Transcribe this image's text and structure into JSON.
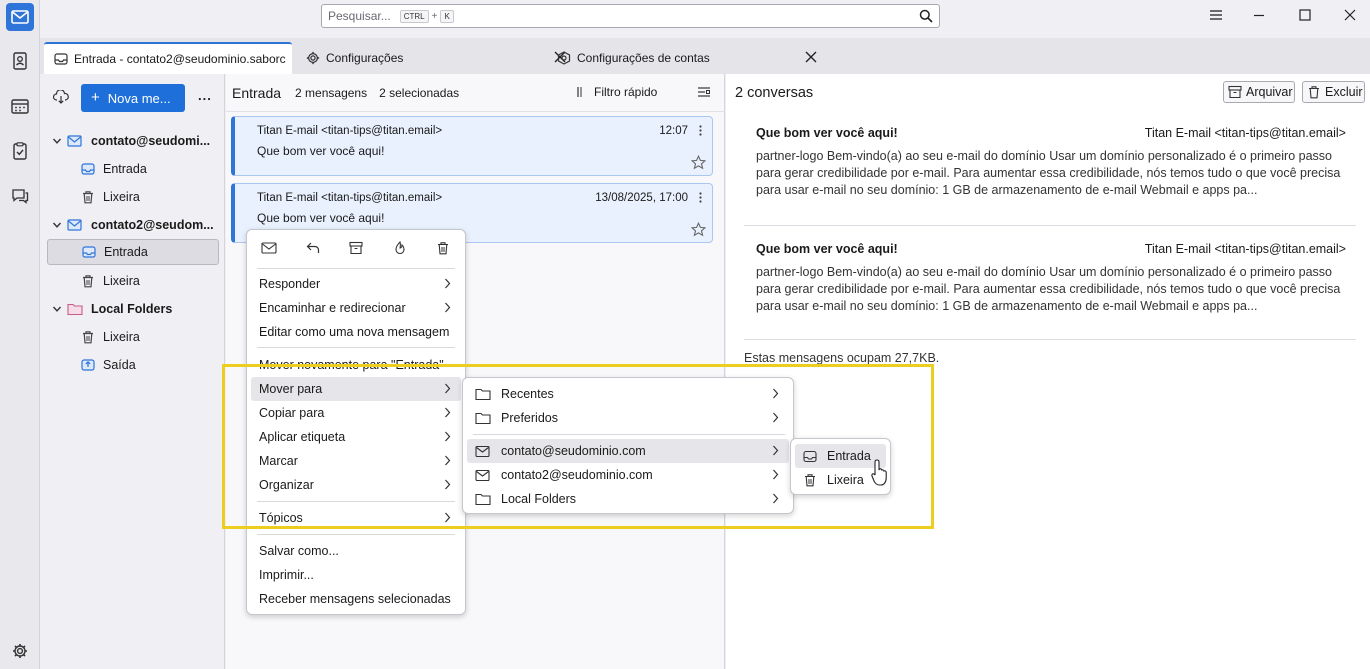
{
  "search": {
    "placeholder": "Pesquisar...",
    "key1": "CTRL",
    "plus": "+",
    "key2": "K"
  },
  "tabs": [
    {
      "label": "Entrada - contato2@seudominio.saborc"
    },
    {
      "label": "Configurações"
    },
    {
      "label": "Configurações de contas"
    }
  ],
  "folder_pane": {
    "new_message": "Nova me...",
    "more": "...",
    "accounts": [
      {
        "name": "contato@seudomi...",
        "folders": [
          "Entrada",
          "Lixeira"
        ]
      },
      {
        "name": "contato2@seudom...",
        "folders": [
          "Entrada",
          "Lixeira"
        ]
      },
      {
        "name": "Local Folders",
        "folders": [
          "Lixeira",
          "Saída"
        ]
      }
    ]
  },
  "thread_pane": {
    "folder": "Entrada",
    "count": "2 mensagens",
    "selected": "2 selecionadas",
    "quick_filter": "Filtro rápido",
    "messages": [
      {
        "from": "Titan E-mail <titan-tips@titan.email>",
        "date": "12:07",
        "subject": "Que bom ver você aqui!"
      },
      {
        "from": "Titan E-mail <titan-tips@titan.email>",
        "date": "13/08/2025, 17:00",
        "subject": "Que bom ver você aqui!"
      }
    ]
  },
  "message_pane": {
    "title": "2 conversas",
    "archive": "Arquivar",
    "delete": "Excluir",
    "items": [
      {
        "subject": "Que bom ver você aqui!",
        "from": "Titan E-mail <titan-tips@titan.email>",
        "preview": "partner-logo Bem-vindo(a) ao seu e-mail do domínio Usar um domínio personalizado é o primeiro passo para gerar credibilidade por e-mail. Para aumentar essa credibilidade, nós temos tudo o que você precisa para usar e-mail no seu domínio: 1 GB de armazenamento de e-mail Webmail e apps pa..."
      },
      {
        "subject": "Que bom ver você aqui!",
        "from": "Titan E-mail <titan-tips@titan.email>",
        "preview": "partner-logo Bem-vindo(a) ao seu e-mail do domínio Usar um domínio personalizado é o primeiro passo para gerar credibilidade por e-mail. Para aumentar essa credibilidade, nós temos tudo o que você precisa para usar e-mail no seu domínio: 1 GB de armazenamento de e-mail Webmail e apps pa..."
      }
    ],
    "size_note": "Estas mensagens ocupam 27,7KB."
  },
  "context_menu": {
    "items": [
      "Responder",
      "Encaminhar e redirecionar",
      "Editar como uma nova mensagem",
      "Mover novamente para \"Entrada\"",
      "Mover para",
      "Copiar para",
      "Aplicar etiqueta",
      "Marcar",
      "Organizar",
      "Tópicos",
      "Salvar como...",
      "Imprimir...",
      "Receber mensagens selecionadas"
    ]
  },
  "move_menu": {
    "items": [
      "Recentes",
      "Preferidos",
      "contato@seudominio.com",
      "contato2@seudominio.com",
      "Local Folders"
    ]
  },
  "folder_menu": {
    "items": [
      "Entrada",
      "Lixeira"
    ]
  },
  "colors": {
    "accent": "#2f74d8",
    "highlight_frame": "#ecce1f"
  }
}
